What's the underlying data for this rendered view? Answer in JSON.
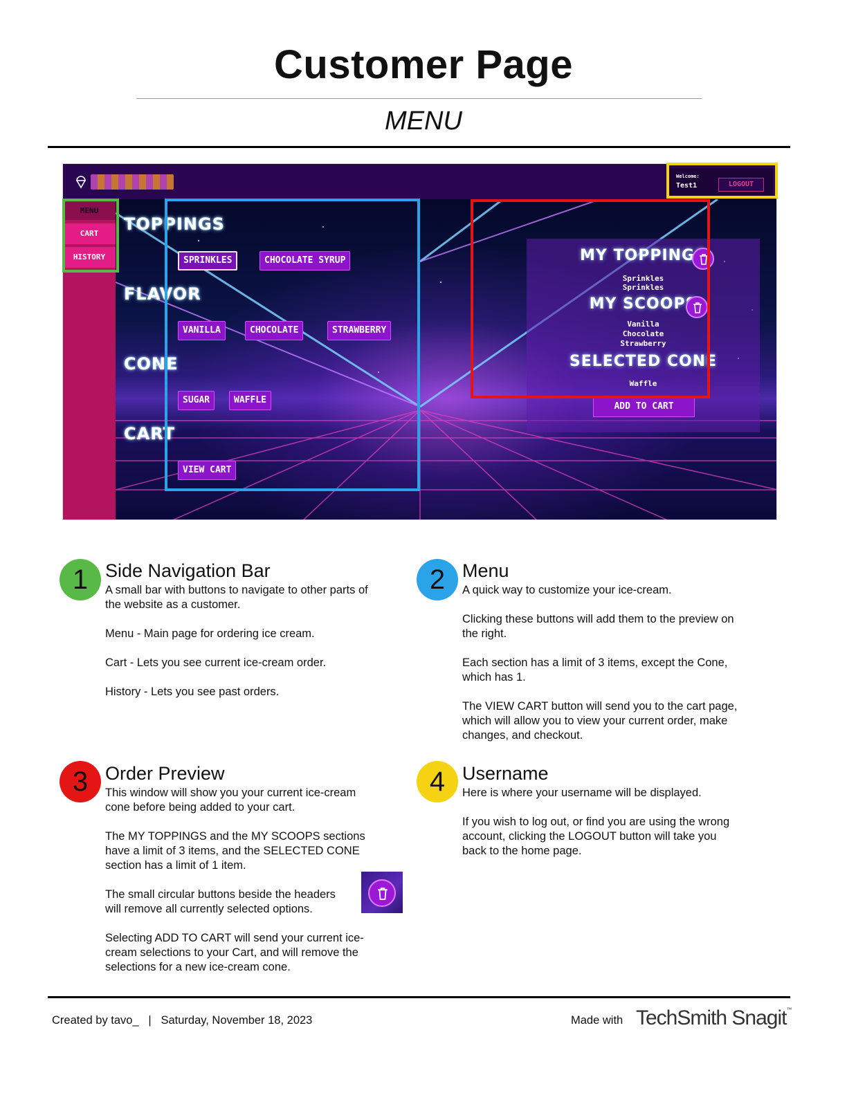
{
  "page": {
    "title": "Customer Page",
    "subtitle": "MENU"
  },
  "app": {
    "welcome_label": "Welcome:",
    "username": "Test1",
    "logout_label": "LOGOUT",
    "sidebar": {
      "items": [
        "MENU",
        "CART",
        "HISTORY"
      ]
    },
    "menu": {
      "sections": [
        {
          "title": "TOPPINGS",
          "options": [
            "SPRINKLES",
            "CHOCOLATE SYRUP"
          ]
        },
        {
          "title": "FLAVOR",
          "options": [
            "VANILLA",
            "CHOCOLATE",
            "STRAWBERRY"
          ]
        },
        {
          "title": "CONE",
          "options": [
            "SUGAR",
            "WAFFLE"
          ]
        },
        {
          "title": "CART",
          "options": [
            "VIEW CART"
          ]
        }
      ]
    },
    "preview": {
      "toppings_title": "MY TOPPINGS",
      "toppings": [
        "Sprinkles",
        "Sprinkles"
      ],
      "scoops_title": "MY SCOOPS",
      "scoops": [
        "Vanilla",
        "Chocolate",
        "Strawberry"
      ],
      "cone_title": "SELECTED CONE",
      "cone": "Waffle",
      "add_to_cart_label": "ADD TO CART"
    }
  },
  "annotations": [
    {
      "number": "1",
      "color": "#58b947",
      "title": "Side Navigation Bar",
      "paragraphs": [
        "A small bar with buttons to navigate to other parts of\nthe website as a customer.",
        "Menu - Main page for ordering ice cream.",
        "Cart - Lets you see current ice-cream order.",
        "History - Lets you see past orders."
      ]
    },
    {
      "number": "2",
      "color": "#2aa3e8",
      "title": "Menu",
      "paragraphs": [
        "A quick way to customize your ice-cream.",
        "Clicking these buttons will add them to the preview on\nthe right.",
        "Each section has a limit of 3 items, except the Cone,\nwhich has 1.",
        "The VIEW CART button will send you to the cart page,\nwhich will allow you to view your current order, make\nchanges, and checkout."
      ]
    },
    {
      "number": "3",
      "color": "#e41515",
      "title": "Order Preview",
      "paragraphs": [
        "This window will show you your current ice-cream\ncone before being added to your cart.",
        "The MY TOPPINGS and the MY SCOOPS sections\nhave a limit of 3 items, and the SELECTED CONE\nsection has a limit of 1 item.",
        "The small circular buttons beside the headers\nwill remove all currently selected options.",
        "Selecting ADD TO CART will send your current ice-\ncream selections to your Cart, and will remove the\nselections for a new ice-cream cone."
      ]
    },
    {
      "number": "4",
      "color": "#f5d313",
      "title": "Username",
      "paragraphs": [
        "Here is where your username will be displayed.",
        "If you wish to log out, or find you are using the wrong\naccount, clicking the LOGOUT button will take you\nback to the home page."
      ]
    }
  ],
  "footer": {
    "credit": "Created by tavo_   |   Saturday, November 18, 2023",
    "made_with": "Made with",
    "brand": "TechSmith Snagit"
  }
}
